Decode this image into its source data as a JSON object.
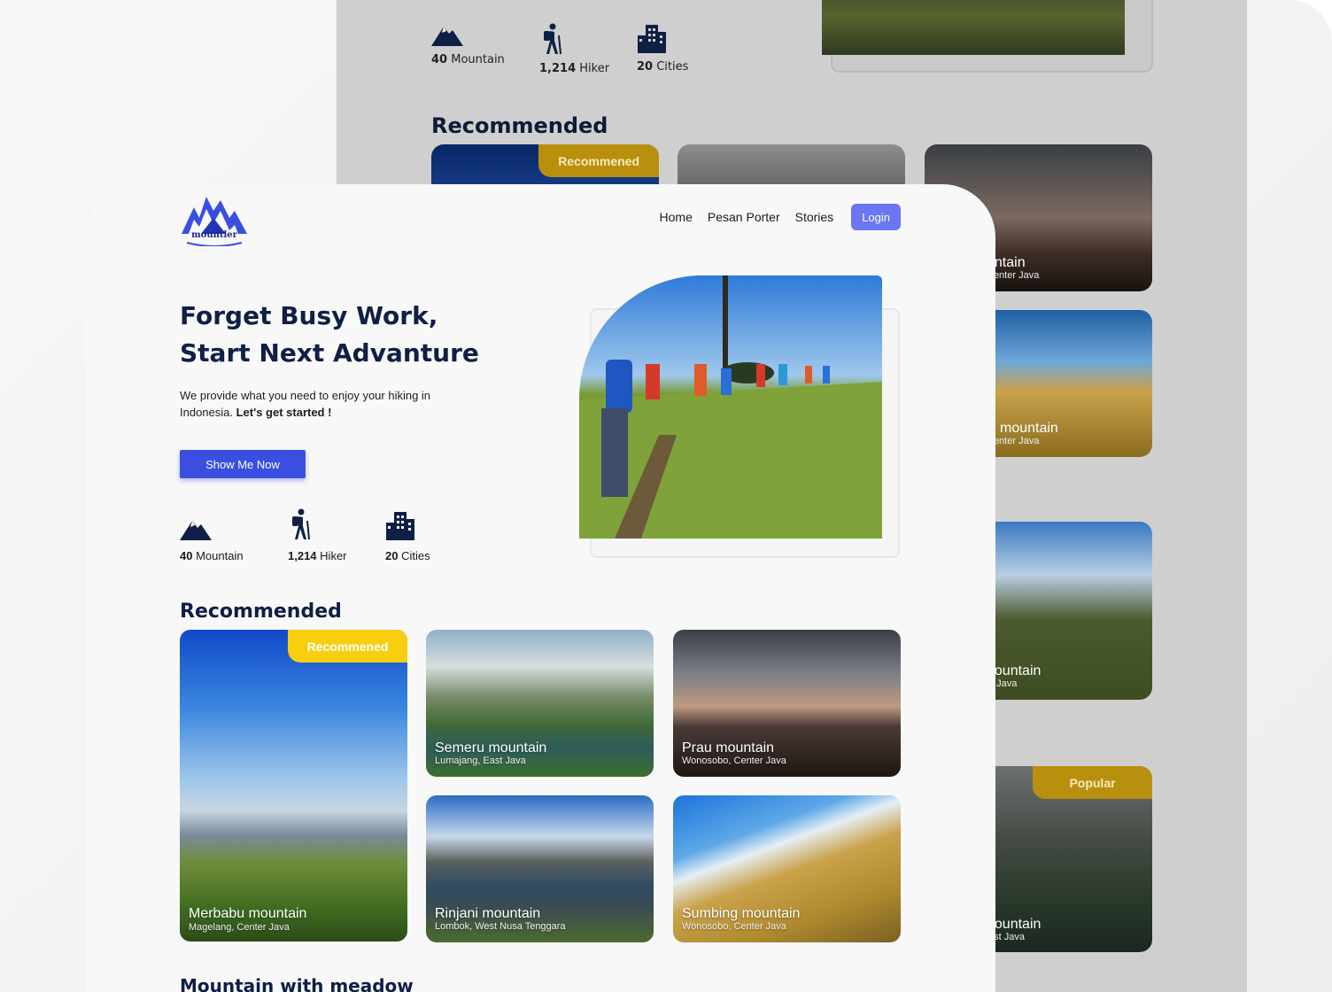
{
  "back": {
    "stats": [
      {
        "value": "40",
        "label": "Mountain",
        "icon": "mountain-icon"
      },
      {
        "value": "1,214",
        "label": "Hiker",
        "icon": "hiker-icon"
      },
      {
        "value": "20",
        "label": "Cities",
        "icon": "city-icon"
      }
    ],
    "heading": "Recommended",
    "badge_recommended": "Recommened",
    "badge_popular": "Popular",
    "cards": [
      {
        "title": "untain",
        "sub": "Center Java"
      },
      {
        "title": "mountain",
        "sub": "Center Java"
      },
      {
        "title": "nountain",
        "sub": "t Java"
      },
      {
        "title": "nountain",
        "sub": "ast Java"
      }
    ]
  },
  "nav": {
    "logo_text": "mountler",
    "links": [
      "Home",
      "Pesan Porter",
      "Stories"
    ],
    "login": "Login"
  },
  "hero": {
    "title_line1": "Forget Busy Work,",
    "title_line2": "Start Next Advanture",
    "desc_plain": "We provide what you need to enjoy your hiking in Indonesia. ",
    "desc_bold": "Let's get started !",
    "cta": "Show Me Now"
  },
  "stats": [
    {
      "value": "40",
      "label": "Mountain",
      "icon": "mountain-icon"
    },
    {
      "value": "1,214",
      "label": "Hiker",
      "icon": "hiker-icon"
    },
    {
      "value": "20",
      "label": "Cities",
      "icon": "city-icon"
    }
  ],
  "recommended": {
    "heading": "Recommended",
    "badge": "Recommened",
    "cards": [
      {
        "title": "Merbabu mountain",
        "sub": "Magelang, Center Java"
      },
      {
        "title": "Semeru mountain",
        "sub": "Lumajang, East Java"
      },
      {
        "title": "Prau mountain",
        "sub": "Wonosobo, Center Java"
      },
      {
        "title": "Rinjani mountain",
        "sub": "Lombok, West Nusa Tenggara"
      },
      {
        "title": "Sumbing mountain",
        "sub": "Wonosobo, Center Java"
      }
    ]
  },
  "next_section": {
    "heading": "Mountain with meadow"
  },
  "colors": {
    "brand": "#3a4fe0",
    "navy": "#0f1f45",
    "badge_yellow": "#f8cf10",
    "login": "#6a76f2"
  }
}
